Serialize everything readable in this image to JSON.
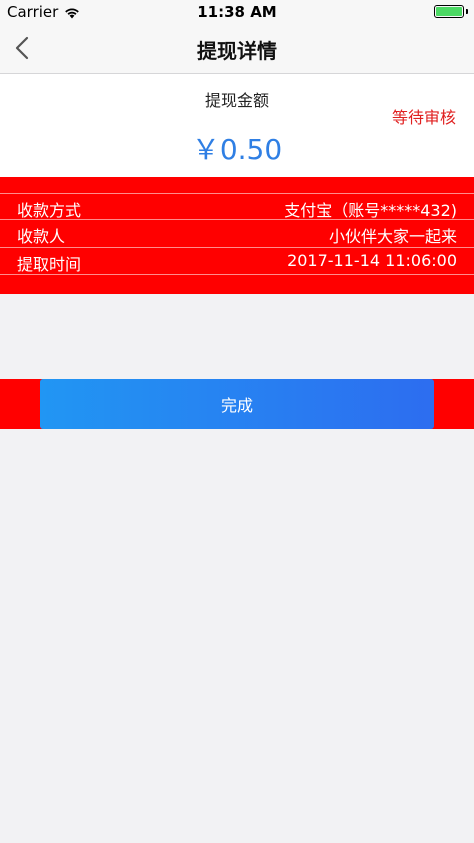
{
  "status_bar": {
    "carrier": "Carrier",
    "time": "11:38 AM",
    "icons": [
      "wifi-icon",
      "battery-icon"
    ],
    "battery_color": "#4cd964"
  },
  "nav": {
    "title": "提现详情",
    "back_icon": "chevron-left-icon"
  },
  "amount": {
    "label": "提现金额",
    "status": "等待审核",
    "value": "￥0.50",
    "value_color": "#2f7fe4",
    "status_color": "#e02020"
  },
  "details": [
    {
      "key": "收款方式",
      "value": "支付宝（账号*****432)"
    },
    {
      "key": "收款人",
      "value": "小伙伴大家一起来"
    },
    {
      "key": "提取时间",
      "value": "2017-11-14  11:06:00"
    }
  ],
  "actions": {
    "done_label": "完成",
    "button_color": "#2196f3",
    "band_color": "#ff0000"
  }
}
